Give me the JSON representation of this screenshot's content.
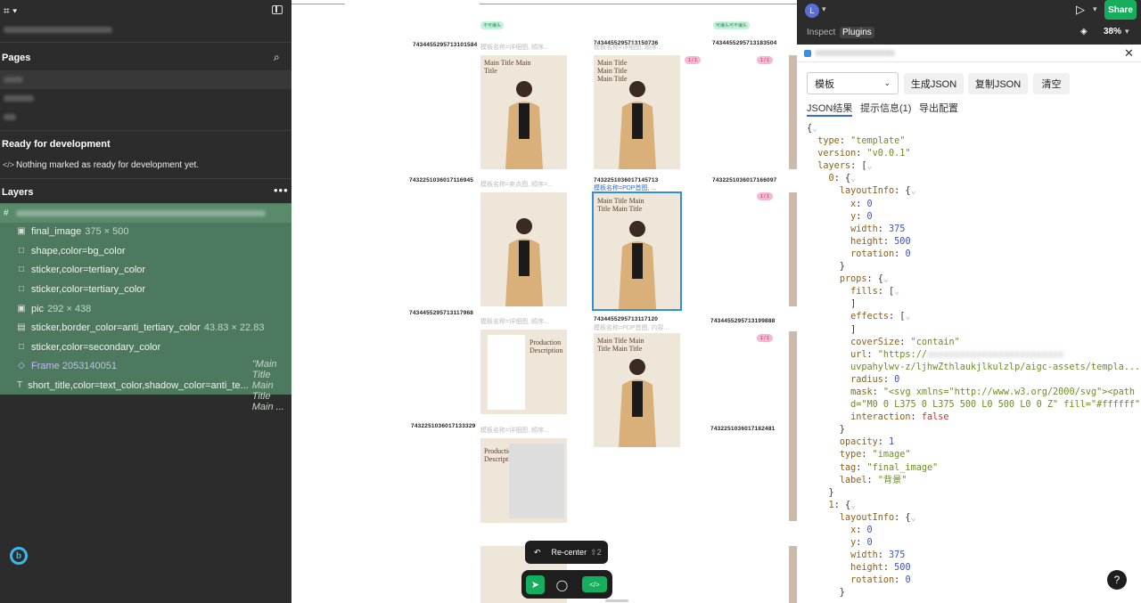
{
  "left_panel": {
    "pages_title": "Pages",
    "ready_title": "Ready for development",
    "ready_message": "Nothing marked as ready for development yet.",
    "layers_title": "Layers",
    "layers": [
      {
        "icon": "image-icon",
        "label": "final_image",
        "meta": "375 × 500"
      },
      {
        "icon": "rectangle-icon",
        "label": "shape,color=bg_color",
        "meta": ""
      },
      {
        "icon": "rectangle-icon",
        "label": "sticker,color=tertiary_color",
        "meta": ""
      },
      {
        "icon": "rectangle-icon",
        "label": "sticker,color=tertiary_color",
        "meta": ""
      },
      {
        "icon": "image-icon",
        "label": "pic",
        "meta": "292 × 438"
      },
      {
        "icon": "rectangle-icon",
        "label": "sticker,border_color=anti_tertiary_color",
        "meta": "43.83 × 22.83"
      },
      {
        "icon": "rectangle-icon",
        "label": "sticker,color=secondary_color",
        "meta": ""
      },
      {
        "icon": "frame-icon",
        "label": "Frame 2053140051",
        "meta": ""
      },
      {
        "icon": "text-icon",
        "label": "short_title,color=text_color,shadow_color=anti_te...",
        "meta": "\"Main Title Main Title Main ..."
      }
    ]
  },
  "right_panel": {
    "avatar_letter": "L",
    "share_label": "Share",
    "tab_inspect": "Inspect",
    "tab_plugins": "Plugins",
    "zoom": "38%",
    "select_value": "模板",
    "btn_gen": "生成JSON",
    "btn_copy": "复制JSON",
    "btn_clear": "清空",
    "ptab_json": "JSON结果",
    "ptab_hint": "提示信息(1)",
    "ptab_export": "导出配置",
    "help_label": "?"
  },
  "canvas": {
    "ids": [
      "7434455295713101584",
      "7434455295713150736",
      "7434455295713183504",
      "7432251036017116945",
      "7432251036017145713",
      "7432251036017166097",
      "7434455295713117968",
      "7434455295713117120",
      "7434455295713199888",
      "7432251036017133329",
      "7432251036017182481"
    ],
    "tag_a": "不可编头",
    "tag_b": "可编头可不编头",
    "captions": [
      "模板名称=详细图, 顺序...",
      "模板名称=详细图, 顺序...",
      "模板名称=卖点图, 顺序=...",
      "模板名称=PDP首图, ...",
      "模板名称=详细图, 顺序...",
      "模板名称=PDP首图, 内容...",
      "模板名称=详细图, 顺序..."
    ],
    "card_title": "Main Title Main Title",
    "card_title_2": "Main Title Main Title Main Title",
    "prod_title": "Production Description",
    "pink_label": "1 / 1",
    "recenter_label": "Re-center",
    "recenter_shortcut": "⇧2"
  }
}
